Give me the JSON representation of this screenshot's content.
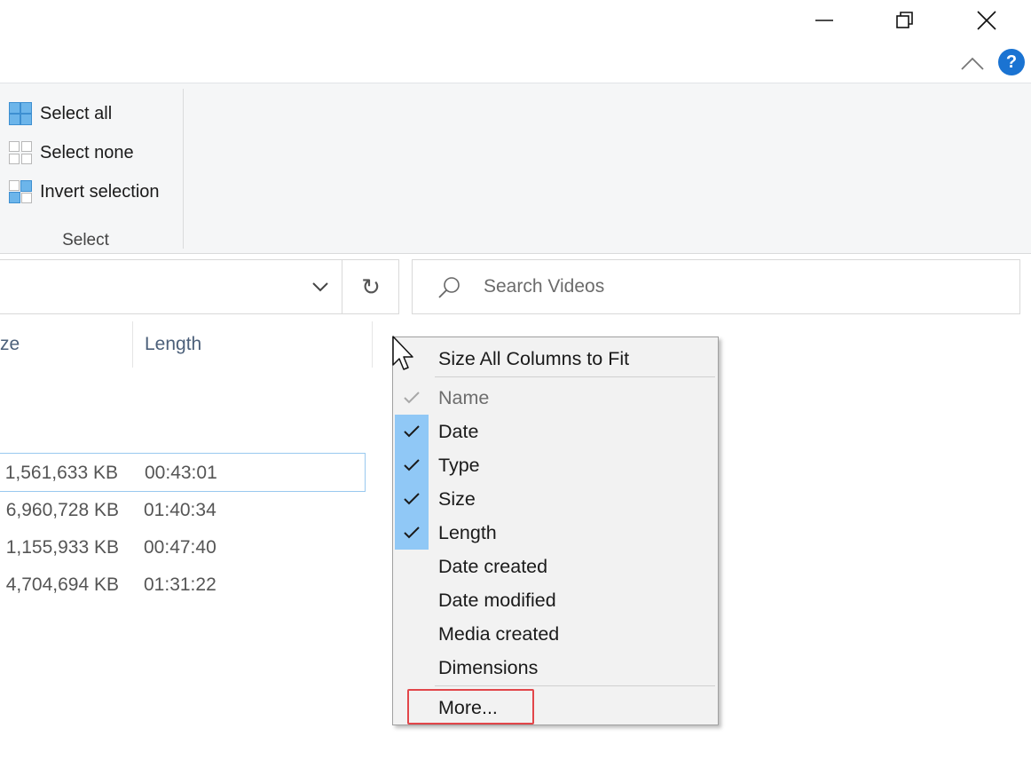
{
  "window": {
    "minimize_icon": "minimize-icon",
    "restore_icon": "restore-icon",
    "close_icon": "close-icon"
  },
  "ribbon": {
    "collapse_icon": "chevron-up-icon",
    "help_label": "?",
    "select_group": {
      "select_all": "Select all",
      "select_none": "Select none",
      "invert_selection": "Invert selection",
      "label": "Select"
    }
  },
  "address_bar": {
    "dropdown_icon": "chevron-down-icon",
    "refresh_label": "↻"
  },
  "search": {
    "placeholder": "Search Videos"
  },
  "columns": {
    "size_partial": "ze",
    "length": "Length"
  },
  "rows": [
    {
      "size": "1,561,633 KB",
      "length": "00:43:01",
      "selected": true
    },
    {
      "size": "6,960,728 KB",
      "length": "01:40:34",
      "selected": false
    },
    {
      "size": "1,155,933 KB",
      "length": "00:47:40",
      "selected": false
    },
    {
      "size": "4,704,694 KB",
      "length": "01:31:22",
      "selected": false
    }
  ],
  "context_menu": {
    "size_all": "Size All Columns to Fit",
    "items": [
      {
        "label": "Name",
        "checked": true,
        "disabled": true
      },
      {
        "label": "Date",
        "checked": true,
        "disabled": false
      },
      {
        "label": "Type",
        "checked": true,
        "disabled": false
      },
      {
        "label": "Size",
        "checked": true,
        "disabled": false
      },
      {
        "label": "Length",
        "checked": true,
        "disabled": false
      },
      {
        "label": "Date created",
        "checked": false,
        "disabled": false
      },
      {
        "label": "Date modified",
        "checked": false,
        "disabled": false
      },
      {
        "label": "Media created",
        "checked": false,
        "disabled": false
      },
      {
        "label": "Dimensions",
        "checked": false,
        "disabled": false
      }
    ],
    "more": "More...",
    "check_color": "#90c8f6",
    "highlight_color": "#e2464a"
  }
}
